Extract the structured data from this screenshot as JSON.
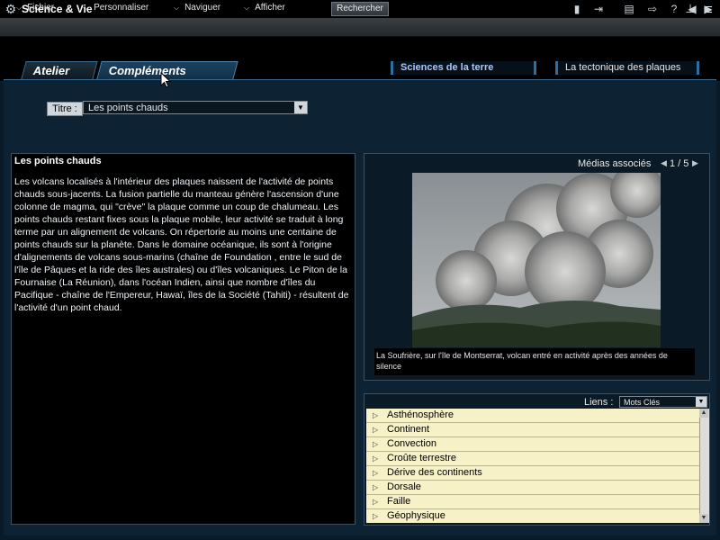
{
  "app": {
    "title": "Science & Vie",
    "logo_icon": "gear-icon",
    "window_controls": [
      "minimize-icon",
      "restore-icon"
    ]
  },
  "menubar": {
    "items": [
      {
        "label": "Fichier",
        "icon": "chevron-down-icon"
      },
      {
        "label": "Personnaliser",
        "icon": "chevron-down-icon"
      },
      {
        "label": "Naviguer",
        "icon": "chevron-down-icon"
      },
      {
        "label": "Afficher",
        "icon": "chevron-down-icon"
      }
    ],
    "search_label": "Rechercher",
    "tools": [
      "bookmark-icon",
      "export-icon",
      "print-icon",
      "exit-icon",
      "help-icon",
      "back-icon",
      "forward-icon"
    ]
  },
  "tabs": [
    {
      "label": "Atelier",
      "active": false
    },
    {
      "label": "Compléments",
      "active": true
    }
  ],
  "breadcrumbs": [
    "Sciences de la terre",
    "La tectonique des plaques"
  ],
  "titre": {
    "label": "Titre :",
    "value": "Les points chauds"
  },
  "article": {
    "title": "Les points chauds",
    "body": "Les volcans localisés à l'intérieur des plaques naissent de l'activité de points chauds sous-jacents. La fusion partielle du manteau génère l'ascension d'une colonne de magma, qui \"crève\" la plaque comme un coup de chalumeau. Les points chauds restant fixes sous la plaque mobile, leur activité se traduit à long terme par un alignement de volcans. On répertorie au moins une centaine de points chauds sur la planète. Dans le domaine océanique, ils sont à l'origine d'alignements de volcans sous-marins (chaîne de Foundation , entre le sud de l'île de Pâques et la ride des îles australes) ou d'îles volcaniques. Le Piton de la Fournaise (La Réunion), dans l'océan Indien, ainsi que nombre d'îles du Pacifique - chaîne de l'Empereur, Hawaï, îles de la Société (Tahiti) - résultent de l'activité d'un point chaud."
  },
  "media": {
    "label": "Médias associés",
    "count": "1 / 5",
    "caption": "La Soufrière, sur l'île de Montserrat, volcan entré en activité après des années de silence"
  },
  "links": {
    "label": "Liens :",
    "filter": "Mots Clés",
    "items": [
      "Asthénosphère",
      "Continent",
      "Convection",
      "Croûte terrestre",
      "Dérive des continents",
      "Dorsale",
      "Faille",
      "Géophysique"
    ]
  }
}
